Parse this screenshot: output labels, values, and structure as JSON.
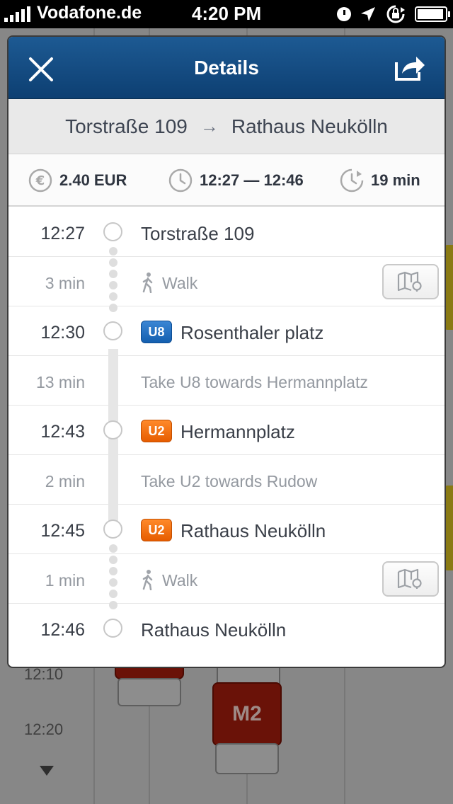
{
  "status_bar": {
    "carrier": "Vodafone.de",
    "time": "4:20 PM"
  },
  "background": {
    "times": [
      "12:10",
      "12:20"
    ],
    "line_label": "M2"
  },
  "nav": {
    "title": "Details"
  },
  "route": {
    "from": "Torstraße 109",
    "arrow": "→",
    "to": "Rathaus Neukölln"
  },
  "summary": {
    "price": "2.40 EUR",
    "time_range": "12:27 — 12:46",
    "duration": "19 min"
  },
  "steps": [
    {
      "time": "12:27",
      "text": "Torstraße 109",
      "type": "stop"
    },
    {
      "time": "3 min",
      "text": "Walk",
      "type": "walk"
    },
    {
      "time": "12:30",
      "text": "Rosenthaler platz",
      "type": "stop",
      "badge": "U8"
    },
    {
      "time": "13 min",
      "text": "Take U8 towards Hermannplatz",
      "type": "ride"
    },
    {
      "time": "12:43",
      "text": "Hermannplatz",
      "type": "stop",
      "badge": "U2"
    },
    {
      "time": "2 min",
      "text": "Take U2 towards Rudow",
      "type": "ride"
    },
    {
      "time": "12:45",
      "text": "Rathaus Neukölln",
      "type": "stop",
      "badge": "U2"
    },
    {
      "time": "1 min",
      "text": "Walk",
      "type": "walk"
    },
    {
      "time": "12:46",
      "text": "Rathaus Neukölln",
      "type": "stop"
    }
  ],
  "colors": {
    "nav_bar": "#0d3f72",
    "u8_line": "#145faf",
    "u2_line": "#e65c00"
  }
}
